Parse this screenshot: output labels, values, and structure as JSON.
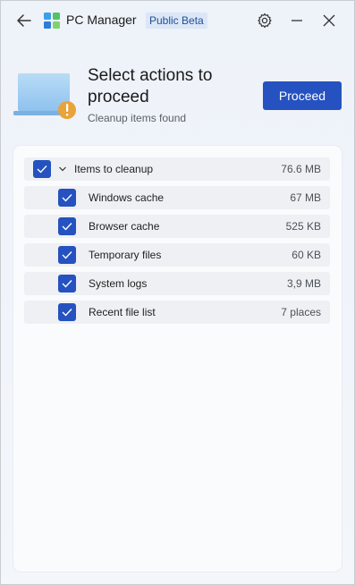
{
  "titlebar": {
    "app_title": "PC Manager",
    "badge": "Public Beta"
  },
  "hero": {
    "title": "Select actions to proceed",
    "subtitle": "Cleanup items found",
    "proceed_label": "Proceed"
  },
  "cleanup": {
    "parent": {
      "label": "Items to cleanup",
      "size": "76.6 MB",
      "checked": true,
      "expanded": true
    },
    "items": [
      {
        "label": "Windows cache",
        "size": "67 MB",
        "checked": true
      },
      {
        "label": "Browser cache",
        "size": "525 KB",
        "checked": true
      },
      {
        "label": "Temporary files",
        "size": "60 KB",
        "checked": true
      },
      {
        "label": "System logs",
        "size": "3,9 MB",
        "checked": true
      },
      {
        "label": "Recent file list",
        "size": "7 places",
        "checked": true
      }
    ]
  },
  "colors": {
    "accent": "#2552c0",
    "warning": "#e8a33a",
    "row_bg": "#eef0f3"
  },
  "icons": [
    "back-arrow-icon",
    "pc-manager-logo-icon",
    "gear-icon",
    "minimize-icon",
    "close-icon",
    "laptop-warning-icon",
    "checkmark-icon",
    "chevron-down-icon"
  ]
}
